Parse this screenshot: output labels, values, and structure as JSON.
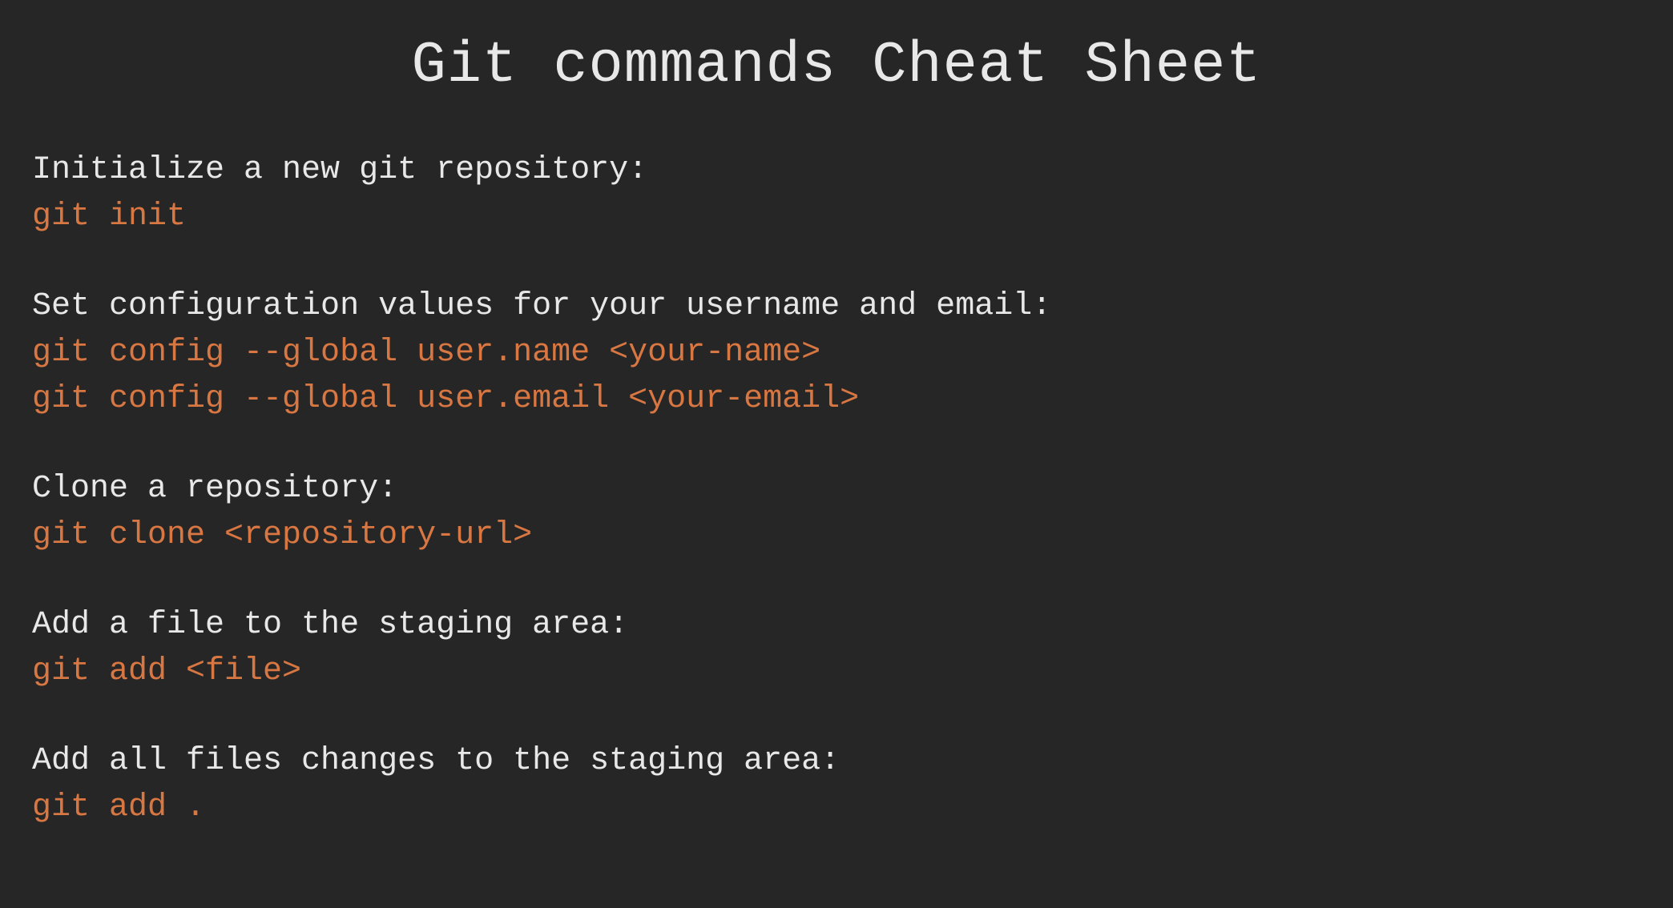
{
  "title": "Git commands Cheat Sheet",
  "sections": [
    {
      "desc": "Initialize a new git repository:",
      "cmds": [
        "git init"
      ]
    },
    {
      "desc": "Set configuration values for your username and email:",
      "cmds": [
        "git config --global user.name <your-name>",
        "git config --global user.email <your-email>"
      ]
    },
    {
      "desc": "Clone a repository:",
      "cmds": [
        "git clone <repository-url>"
      ]
    },
    {
      "desc": "Add a file to the staging area:",
      "cmds": [
        "git add <file>"
      ]
    },
    {
      "desc": "Add all files changes to the staging area:",
      "cmds": [
        "git add ."
      ]
    }
  ]
}
